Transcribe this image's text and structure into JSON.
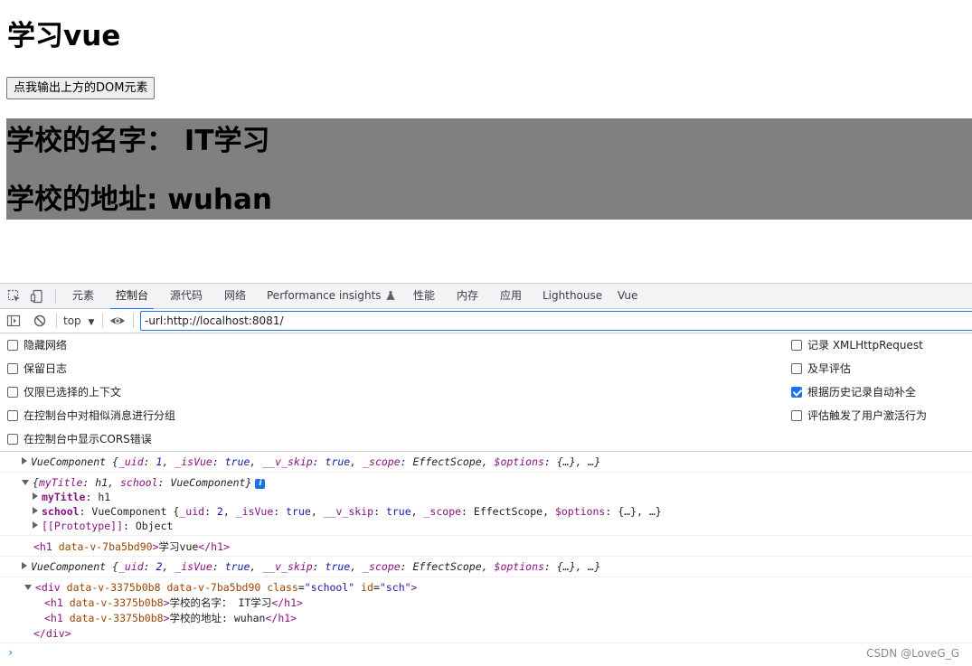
{
  "page": {
    "title": "学习vue",
    "button_label": "点我输出上方的DOM元素",
    "school_name_line": "学校的名字：  IT学习",
    "school_address_line": "学校的地址: wuhan",
    "school_bg": "#808080"
  },
  "devtools": {
    "tabs": [
      {
        "label": "元素"
      },
      {
        "label": "控制台"
      },
      {
        "label": "源代码"
      },
      {
        "label": "网络"
      },
      {
        "label": "Performance insights"
      },
      {
        "label": "性能"
      },
      {
        "label": "内存"
      },
      {
        "label": "应用"
      },
      {
        "label": "Lighthouse"
      },
      {
        "label": "Vue"
      }
    ],
    "active_tab": "控制台",
    "context": "top",
    "filter_value": "-url:http://localhost:8081/",
    "settings_left": [
      {
        "label": "隐藏网络",
        "checked": false
      },
      {
        "label": "保留日志",
        "checked": false
      },
      {
        "label": "仅限已选择的上下文",
        "checked": false
      },
      {
        "label": "在控制台中对相似消息进行分组",
        "checked": false
      },
      {
        "label": "在控制台中显示CORS错误",
        "checked": false
      }
    ],
    "settings_right": [
      {
        "label": "记录 XMLHttpRequest",
        "checked": false
      },
      {
        "label": "及早评估",
        "checked": false
      },
      {
        "label": "根据历史记录自动补全",
        "checked": true
      },
      {
        "label": "评估触发了用户激活行为",
        "checked": false
      }
    ],
    "console": {
      "msg1": {
        "name": "VueComponent",
        "open": "{",
        "k1": "_uid",
        "v1": "1",
        "k2": "_isVue",
        "v2": "true",
        "k3": "__v_skip",
        "v3": "true",
        "k4": "_scope",
        "v4": "EffectScope",
        "k5": "$options",
        "v5": "{…}",
        "tail": ", …}"
      },
      "msg2": {
        "summary_k1": "myTitle",
        "summary_v1": "h1",
        "summary_k2": "school",
        "summary_v2": "VueComponent",
        "info": "i",
        "row1_k": "myTitle",
        "row1_v": "h1",
        "row2_k": "school",
        "row2_v": "VueComponent",
        "row2_k1": "_uid",
        "row2_v1": "2",
        "row2_k2": "_isVue",
        "row2_v2": "true",
        "row2_k3": "__v_skip",
        "row2_v3": "true",
        "row2_k4": "_scope",
        "row2_v4": "EffectScope",
        "row2_k5": "$options",
        "row2_v5": "{…}",
        "row3_k": "[[Prototype]]",
        "row3_v": "Object"
      },
      "msg3": {
        "tag_open": "<h1",
        "attr": "data-v-7ba5bd90",
        "close": ">",
        "text": "学习vue",
        "tag_end": "</h1>"
      },
      "msg4": {
        "name": "VueComponent",
        "k1": "_uid",
        "v1": "2",
        "k2": "_isVue",
        "v2": "true",
        "k3": "__v_skip",
        "v3": "true",
        "k4": "_scope",
        "v4": "EffectScope",
        "k5": "$options",
        "v5": "{…}"
      },
      "msg5": {
        "div_open": "<div",
        "a1": "data-v-3375b0b8",
        "a2": "data-v-7ba5bd90",
        "a3n": "class",
        "a3v": "\"school\"",
        "a4n": "id",
        "a4v": "\"sch\"",
        "close": ">",
        "h1a_attr": "data-v-3375b0b8",
        "h1a_text": "学校的名字：  IT学习",
        "h1b_attr": "data-v-3375b0b8",
        "h1b_text": "学校的地址: wuhan",
        "div_end": "</div>"
      },
      "prompt": "›"
    },
    "watermark": "CSDN @LoveG_G"
  }
}
